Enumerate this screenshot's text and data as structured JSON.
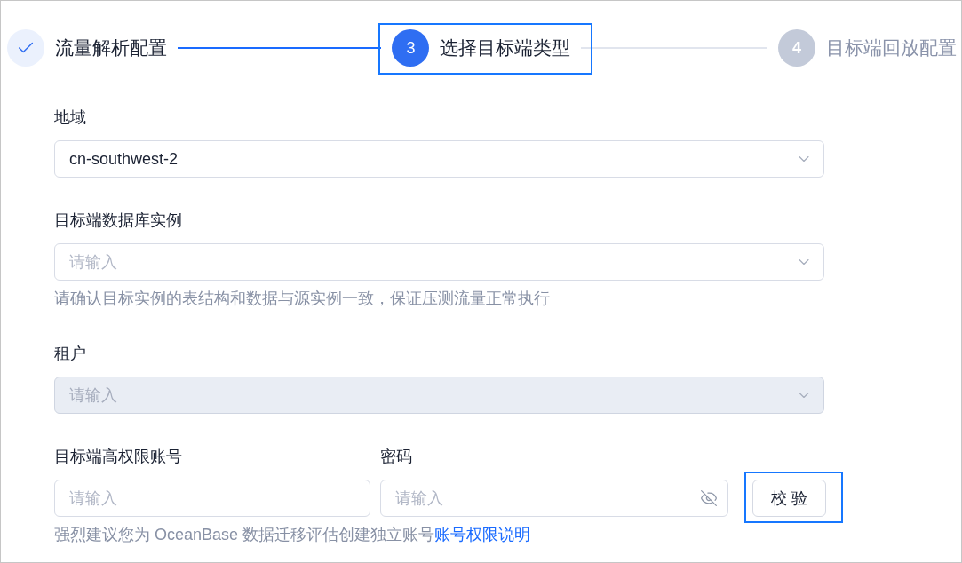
{
  "steps": [
    {
      "completed": true,
      "selected": false,
      "label": "流量解析配置",
      "highlighted": false
    },
    {
      "completed": false,
      "selected": true,
      "number": "3",
      "label": "选择目标端类型",
      "highlighted": true
    },
    {
      "completed": false,
      "selected": false,
      "number": "4",
      "label": "目标端回放配置",
      "highlighted": false
    }
  ],
  "fields": [
    {
      "label": "地域",
      "value": "cn-southwest-2",
      "disabled": false
    },
    {
      "label": "目标端数据库实例",
      "placeholder": "请输入",
      "help": "请确认目标实例的表结构和数据与源实例一致，保证压测流量正常执行",
      "disabled": false
    },
    {
      "label": "租户",
      "placeholder": "请输入",
      "disabled": true
    }
  ],
  "credentials": {
    "account": {
      "label": "目标端高权限账号",
      "placeholder": "请输入"
    },
    "password": {
      "label": "密码",
      "placeholder": "请输入",
      "masked": true
    },
    "verify_button": {
      "label": "校 验",
      "highlighted": true
    },
    "help": "强烈建议您为 OceanBase 数据迁移评估创建独立账号",
    "help_link": "账号权限说明"
  }
}
